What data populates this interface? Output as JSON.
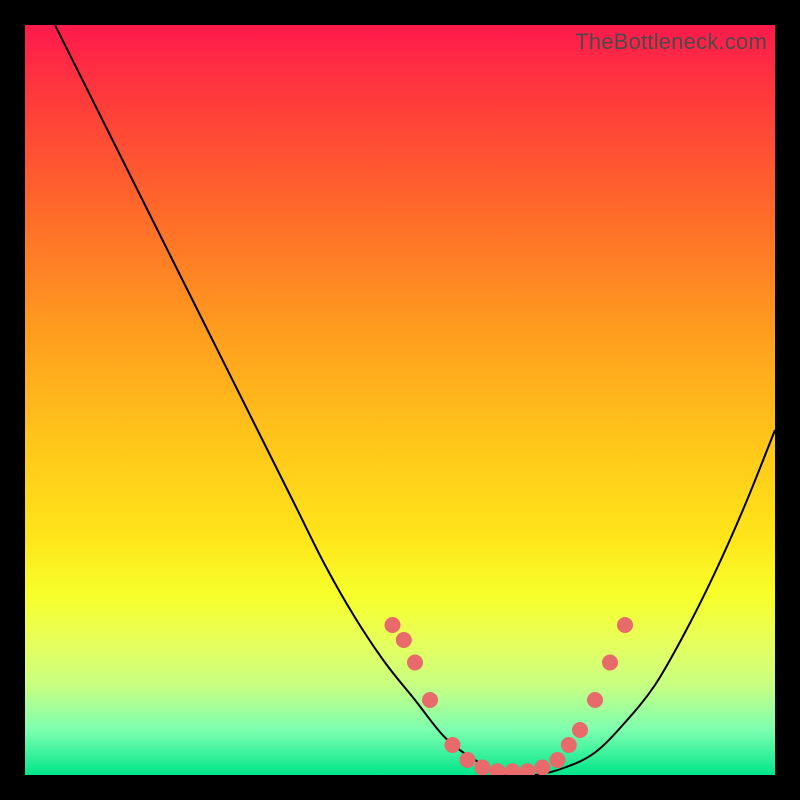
{
  "watermark": "TheBottleneck.com",
  "colors": {
    "curve": "#000000",
    "marker_fill": "#e86a6a",
    "marker_stroke": "#c94f4f",
    "background_frame": "#000000"
  },
  "chart_data": {
    "type": "line",
    "title": "",
    "xlabel": "",
    "ylabel": "",
    "xlim": [
      0,
      100
    ],
    "ylim": [
      0,
      100
    ],
    "grid": false,
    "series": [
      {
        "name": "bottleneck-curve",
        "x": [
          4,
          8,
          12,
          16,
          20,
          24,
          28,
          32,
          36,
          40,
          44,
          48,
          52,
          56,
          60,
          64,
          68,
          72,
          76,
          80,
          84,
          88,
          92,
          96,
          100
        ],
        "y": [
          100,
          92,
          84,
          76,
          68,
          60,
          52,
          44,
          36,
          28,
          21,
          15,
          10,
          5,
          2,
          0,
          0,
          1,
          3,
          7,
          12,
          19,
          27,
          36,
          46
        ]
      }
    ],
    "markers": {
      "name": "highlight-points",
      "x": [
        49,
        50.5,
        52,
        54,
        57,
        59,
        61,
        63,
        65,
        67,
        69,
        71,
        72.5,
        74,
        76,
        78,
        80
      ],
      "y": [
        20,
        18,
        15,
        10,
        4,
        2,
        1,
        0.5,
        0.5,
        0.5,
        1,
        2,
        4,
        6,
        10,
        15,
        20
      ]
    }
  }
}
